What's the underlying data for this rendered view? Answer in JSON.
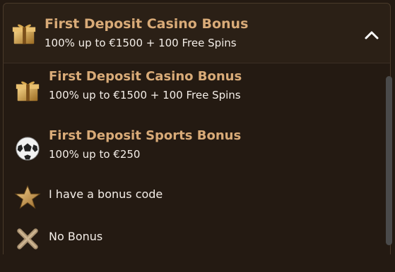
{
  "selected": {
    "title": "First Deposit Casino Bonus",
    "subtitle": "100% up to €1500 + 100 Free Spins",
    "icon": "gift-icon"
  },
  "options": [
    {
      "title": "First Deposit Casino Bonus",
      "subtitle": "100% up to €1500 + 100 Free Spins",
      "icon": "gift-icon"
    },
    {
      "title": "First Deposit Sports Bonus",
      "subtitle": "100% up to €250",
      "icon": "soccer-ball-icon"
    },
    {
      "label": "I have a bonus code",
      "icon": "star-icon"
    },
    {
      "label": "No Bonus",
      "icon": "x-icon"
    }
  ],
  "colors": {
    "accent": "#d9ab78",
    "text": "#f4eee8",
    "background": "#241a12"
  }
}
